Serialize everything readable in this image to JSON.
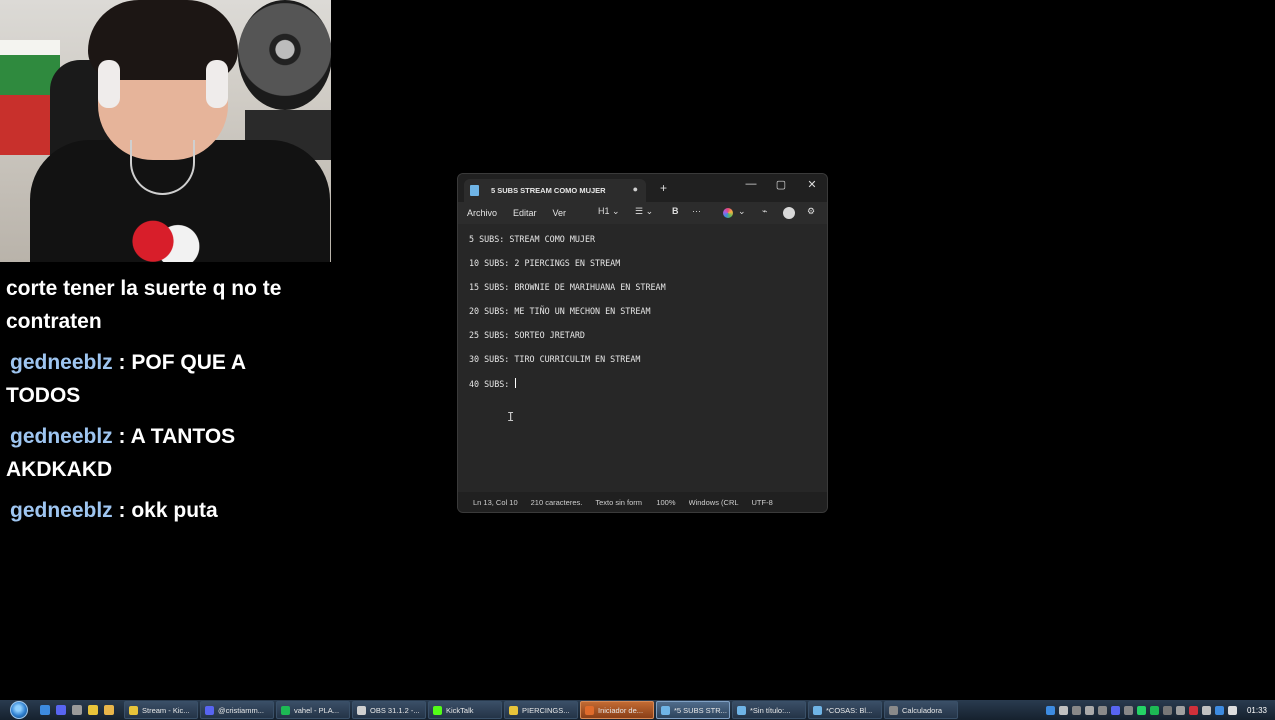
{
  "notepad": {
    "tab_title": "5 SUBS STREAM COMO MUJER",
    "menu": [
      "Archivo",
      "Editar",
      "Ver"
    ],
    "toolbar": {
      "heading": "H1",
      "bold": "B",
      "more": "···"
    },
    "lines": [
      "5 SUBS: STREAM COMO MUJER",
      "10 SUBS: 2 PIERCINGS EN STREAM",
      "15 SUBS: BROWNIE DE MARIHUANA EN STREAM",
      "20 SUBS: ME TIÑO UN MECHON EN STREAM",
      "25 SUBS: SORTEO JRETARD",
      "30 SUBS: TIRO CURRICULIM EN STREAM",
      "40 SUBS: "
    ],
    "status": {
      "position": "Ln 13, Col 10",
      "chars": "210 caracteres.",
      "type": "Texto sin form",
      "zoom": "100%",
      "line_ending": "Windows (CRL",
      "encoding": "UTF-8"
    }
  },
  "chat": {
    "partial_message": "corte tener la suerte q no te contraten",
    "messages": [
      {
        "user": "gedneeblz",
        "text": ": POF QUE A TODOS"
      },
      {
        "user": "gedneeblz",
        "text": ": A TANTOS AKDKAKD"
      },
      {
        "user": "gedneeblz",
        "text": ": okk puta"
      }
    ]
  },
  "taskbar": {
    "tasks": [
      {
        "label": "Stream - Kic...",
        "icon_color": "#e8c43a"
      },
      {
        "label": "@cristiamm...",
        "icon_color": "#5865f2"
      },
      {
        "label": "vahel - PLA...",
        "icon_color": "#1db954"
      },
      {
        "label": "OBS 31.1.2 -...",
        "icon_color": "#d0d0d0"
      },
      {
        "label": "KickTalk",
        "icon_color": "#53fc18"
      },
      {
        "label": "PIERCINGS...",
        "icon_color": "#e8c43a"
      },
      {
        "label": "Iniciador de...",
        "icon_color": "#e06b2b"
      },
      {
        "label": "*5 SUBS STR...",
        "icon_color": "#6fb4e6"
      },
      {
        "label": "*Sin título:...",
        "icon_color": "#6fb4e6"
      },
      {
        "label": "*COSAS: Bl...",
        "icon_color": "#6fb4e6"
      },
      {
        "label": "Calculadora",
        "icon_color": "#8a8a8a"
      }
    ],
    "clock": "01:33"
  }
}
